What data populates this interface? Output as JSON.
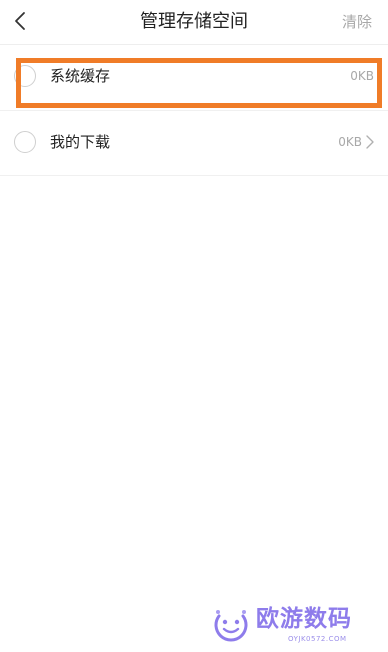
{
  "header": {
    "title": "管理存储空间",
    "clear_label": "清除"
  },
  "items": [
    {
      "label": "系统缓存",
      "size": "0KB",
      "checked": false,
      "has_chevron": false
    },
    {
      "label": "我的下载",
      "size": "0KB",
      "checked": false,
      "has_chevron": true
    }
  ],
  "annotation": {
    "highlight_color": "#f07c28"
  },
  "watermark": {
    "title": "欧游数码",
    "subtitle": "OYJK0572.COM",
    "color": "#7b66e8"
  },
  "icons": {
    "back": "chevron-left-icon",
    "forward": "chevron-right-icon"
  }
}
